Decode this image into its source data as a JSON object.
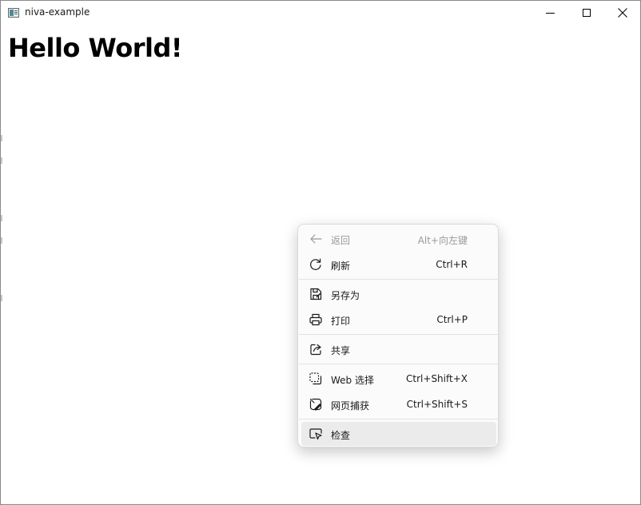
{
  "window": {
    "title": "niva-example",
    "icon": "app-window-icon",
    "controls": [
      "minimize-icon",
      "maximize-icon",
      "close-icon"
    ]
  },
  "page": {
    "heading": "Hello World!"
  },
  "context_menu": {
    "items": [
      {
        "label": "返回",
        "shortcut": "Alt+向左键",
        "icon": "arrow-left-icon",
        "enabled": false
      },
      {
        "label": "刷新",
        "shortcut": "Ctrl+R",
        "icon": "refresh-icon",
        "enabled": true
      },
      {
        "label": "另存为",
        "shortcut": "",
        "icon": "save-icon",
        "enabled": true
      },
      {
        "label": "打印",
        "shortcut": "Ctrl+P",
        "icon": "printer-icon",
        "enabled": true
      },
      {
        "label": "共享",
        "shortcut": "",
        "icon": "share-icon",
        "enabled": true
      },
      {
        "label": "Web 选择",
        "shortcut": "Ctrl+Shift+X",
        "icon": "web-select-icon",
        "enabled": true
      },
      {
        "label": "网页捕获",
        "shortcut": "Ctrl+Shift+S",
        "icon": "web-capture-icon",
        "enabled": true
      },
      {
        "label": "检查",
        "shortcut": "",
        "icon": "inspect-icon",
        "enabled": true,
        "highlighted": true
      }
    ]
  }
}
